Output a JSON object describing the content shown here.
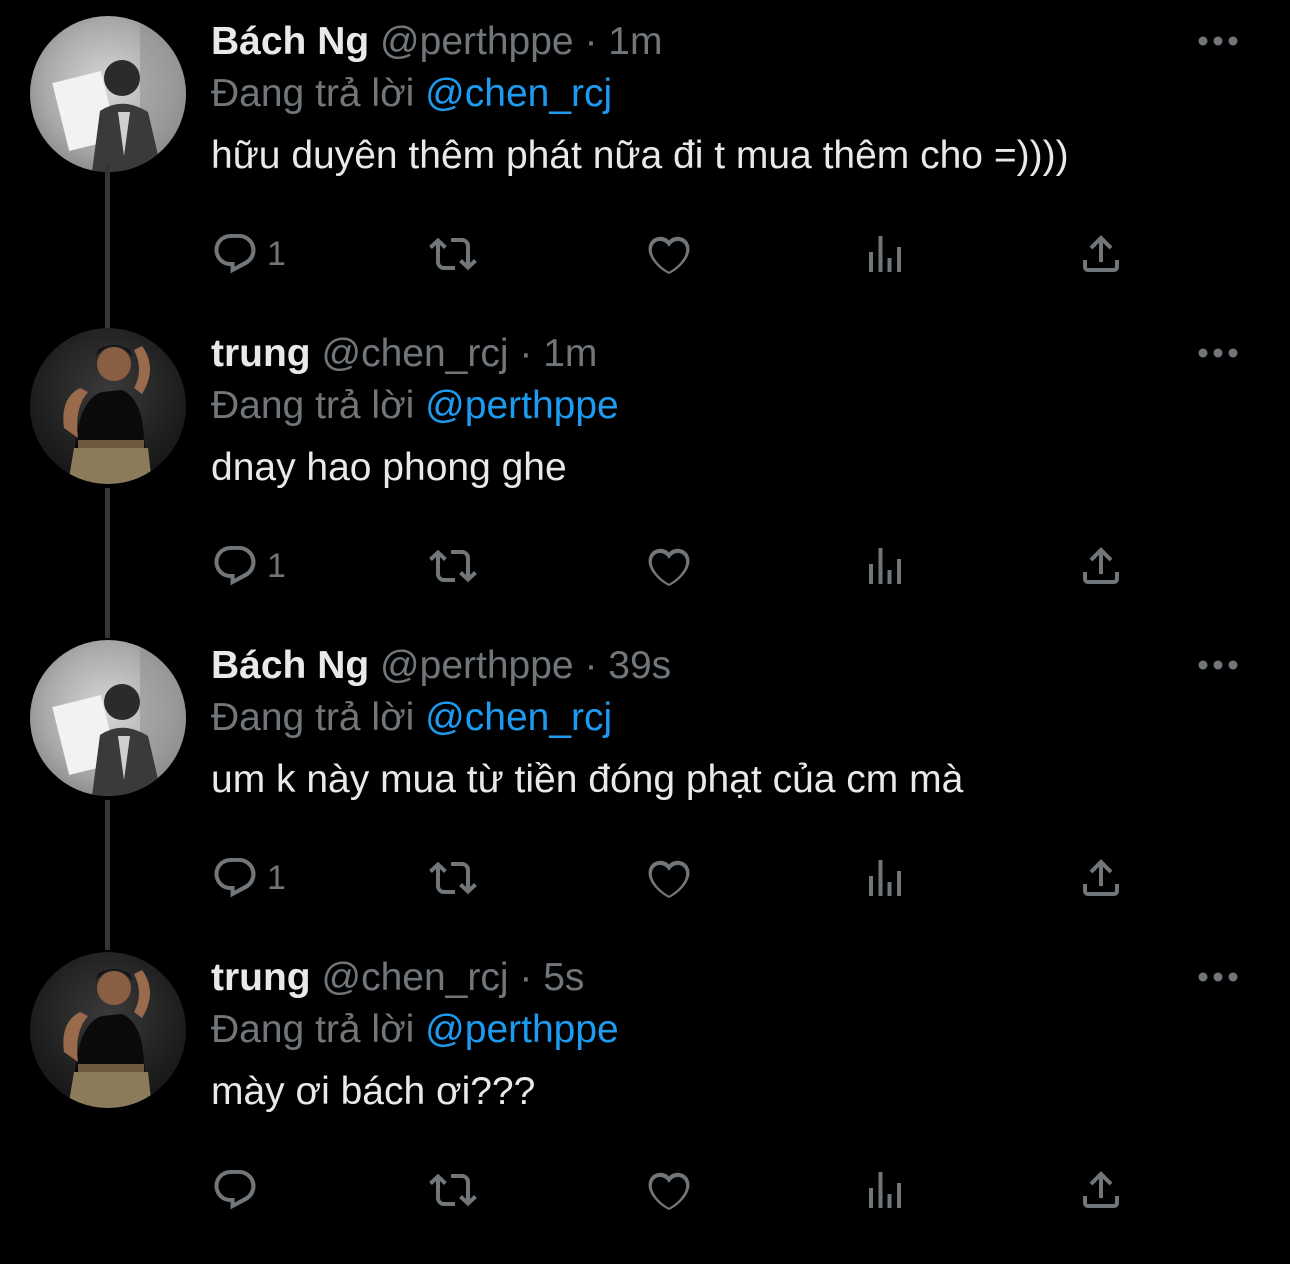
{
  "tweets": [
    {
      "name": "Bách Ng",
      "handle": "@perthppe",
      "dot": "·",
      "time": "1m",
      "reply_prefix": "Đang trả lời",
      "reply_to": "@chen_rcj",
      "text": "hữu duyên thêm phát nữa đi t mua thêm cho =))))",
      "reply_count": "1",
      "avatar": "avatar-bach"
    },
    {
      "name": "trung",
      "handle": "@chen_rcj",
      "dot": "·",
      "time": "1m",
      "reply_prefix": "Đang trả lời",
      "reply_to": "@perthppe",
      "text": "dnay hao phong ghe",
      "reply_count": "1",
      "avatar": "avatar-trung"
    },
    {
      "name": "Bách Ng",
      "handle": "@perthppe",
      "dot": "·",
      "time": "39s",
      "reply_prefix": "Đang trả lời",
      "reply_to": "@chen_rcj",
      "text": "um k này mua từ tiền đóng phạt của cm mà",
      "reply_count": "1",
      "avatar": "avatar-bach"
    },
    {
      "name": "trung",
      "handle": "@chen_rcj",
      "dot": "·",
      "time": "5s",
      "reply_prefix": "Đang trả lời",
      "reply_to": "@perthppe",
      "text": "mày ơi bách ơi???",
      "reply_count": "",
      "avatar": "avatar-trung"
    }
  ],
  "icons": {
    "reply": "reply-icon",
    "retweet": "retweet-icon",
    "like": "heart-icon",
    "views": "views-icon",
    "share": "share-icon",
    "more": "more-icon"
  },
  "colors": {
    "background": "#000000",
    "primary_text": "#e7e9ea",
    "secondary_text": "#71767b",
    "mention": "#1d9bf0",
    "thread_line": "#333639"
  }
}
